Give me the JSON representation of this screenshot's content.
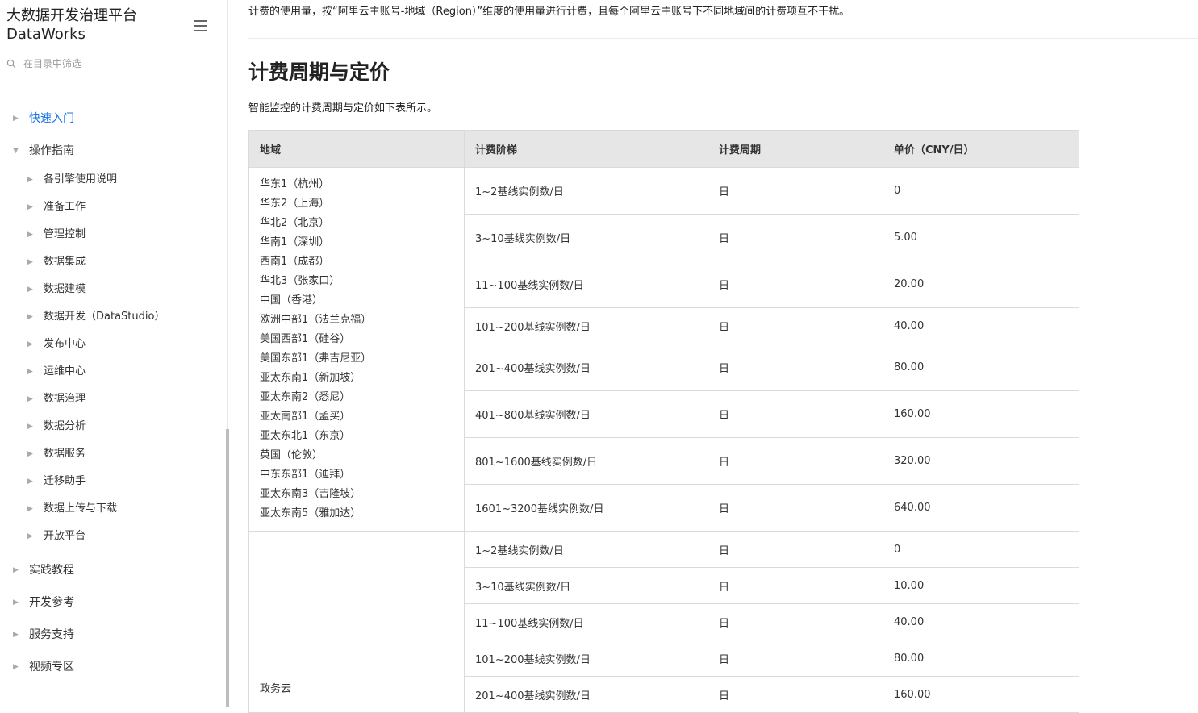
{
  "sidebar": {
    "brand_title": "大数据开发治理平台",
    "brand_subtitle": "DataWorks",
    "search_placeholder": "在目录中筛选",
    "items": [
      {
        "label": "快速入门",
        "level": 1,
        "active": true,
        "expanded": false
      },
      {
        "label": "操作指南",
        "level": 1,
        "active": false,
        "expanded": true
      },
      {
        "label": "各引擎使用说明",
        "level": 2
      },
      {
        "label": "准备工作",
        "level": 2
      },
      {
        "label": "管理控制",
        "level": 2
      },
      {
        "label": "数据集成",
        "level": 2
      },
      {
        "label": "数据建模",
        "level": 2
      },
      {
        "label": "数据开发（DataStudio）",
        "level": 2
      },
      {
        "label": "发布中心",
        "level": 2
      },
      {
        "label": "运维中心",
        "level": 2
      },
      {
        "label": "数据治理",
        "level": 2
      },
      {
        "label": "数据分析",
        "level": 2
      },
      {
        "label": "数据服务",
        "level": 2
      },
      {
        "label": "迁移助手",
        "level": 2
      },
      {
        "label": "数据上传与下载",
        "level": 2
      },
      {
        "label": "开放平台",
        "level": 2
      },
      {
        "label": "实践教程",
        "level": 1
      },
      {
        "label": "开发参考",
        "level": 1
      },
      {
        "label": "服务支持",
        "level": 1
      },
      {
        "label": "视频专区",
        "level": 1
      }
    ]
  },
  "content": {
    "intro_text": "计费的使用量，按“阿里云主账号-地域（Region）”维度的使用量进行计费，且每个阿里云主账号下不同地域间的计费项互不干扰。",
    "heading": "计费周期与定价",
    "description": "智能监控的计费周期与定价如下表所示。",
    "table": {
      "headers": [
        "地域",
        "计费阶梯",
        "计费周期",
        "单价（CNY/日）"
      ],
      "groups": [
        {
          "regions": [
            "华东1（杭州）",
            "华东2（上海）",
            "华北2（北京）",
            "华南1（深圳）",
            "西南1（成都）",
            "华北3（张家口）",
            "中国（香港）",
            "欧洲中部1（法兰克福）",
            "美国西部1（硅谷）",
            "美国东部1（弗吉尼亚）",
            "亚太东南1（新加坡）",
            "亚太东南2（悉尼）",
            "亚太南部1（孟买）",
            "亚太东北1（东京）",
            "英国（伦敦）",
            "中东东部1（迪拜）",
            "亚太东南3（吉隆坡）",
            "亚太东南5（雅加达）"
          ],
          "rows": [
            {
              "tier": "1~2基线实例数/日",
              "period": "日",
              "price": "0"
            },
            {
              "tier": "3~10基线实例数/日",
              "period": "日",
              "price": "5.00"
            },
            {
              "tier": "11~100基线实例数/日",
              "period": "日",
              "price": "20.00"
            },
            {
              "tier": "101~200基线实例数/日",
              "period": "日",
              "price": "40.00"
            },
            {
              "tier": "201~400基线实例数/日",
              "period": "日",
              "price": "80.00"
            },
            {
              "tier": "401~800基线实例数/日",
              "period": "日",
              "price": "160.00"
            },
            {
              "tier": "801~1600基线实例数/日",
              "period": "日",
              "price": "320.00"
            },
            {
              "tier": "1601~3200基线实例数/日",
              "period": "日",
              "price": "640.00"
            }
          ]
        },
        {
          "regions": [
            "政务云"
          ],
          "rows": [
            {
              "tier": "1~2基线实例数/日",
              "period": "日",
              "price": "0"
            },
            {
              "tier": "3~10基线实例数/日",
              "period": "日",
              "price": "10.00"
            },
            {
              "tier": "11~100基线实例数/日",
              "period": "日",
              "price": "40.00"
            },
            {
              "tier": "101~200基线实例数/日",
              "period": "日",
              "price": "80.00"
            },
            {
              "tier": "201~400基线实例数/日",
              "period": "日",
              "price": "160.00"
            }
          ]
        }
      ]
    }
  },
  "colors": {
    "active_link": "#1a73e8",
    "header_bg": "#e6e6e6",
    "border": "#dadada"
  },
  "icons": {
    "menu_toggle": "hamburger-icon",
    "search": "search-icon",
    "nav_caret": "caret-icon"
  }
}
